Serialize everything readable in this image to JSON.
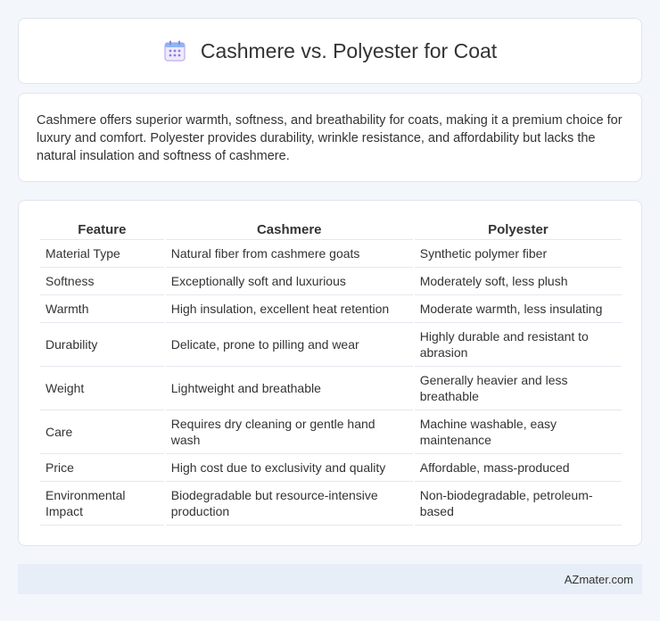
{
  "header": {
    "title": "Cashmere vs. Polyester for Coat",
    "icon": "calendar-grid-icon",
    "icon_color": "#8f7be0"
  },
  "intro": {
    "text": "Cashmere offers superior warmth, softness, and breathability for coats, making it a premium choice for luxury and comfort. Polyester provides durability, wrinkle resistance, and affordability but lacks the natural insulation and softness of cashmere."
  },
  "table": {
    "headers": [
      "Feature",
      "Cashmere",
      "Polyester"
    ],
    "rows": [
      {
        "feature": "Material Type",
        "cashmere": "Natural fiber from cashmere goats",
        "polyester": "Synthetic polymer fiber"
      },
      {
        "feature": "Softness",
        "cashmere": "Exceptionally soft and luxurious",
        "polyester": "Moderately soft, less plush"
      },
      {
        "feature": "Warmth",
        "cashmere": "High insulation, excellent heat retention",
        "polyester": "Moderate warmth, less insulating"
      },
      {
        "feature": "Durability",
        "cashmere": "Delicate, prone to pilling and wear",
        "polyester": "Highly durable and resistant to abrasion"
      },
      {
        "feature": "Weight",
        "cashmere": "Lightweight and breathable",
        "polyester": "Generally heavier and less breathable"
      },
      {
        "feature": "Care",
        "cashmere": "Requires dry cleaning or gentle hand wash",
        "polyester": "Machine washable, easy maintenance"
      },
      {
        "feature": "Price",
        "cashmere": "High cost due to exclusivity and quality",
        "polyester": "Affordable, mass-produced"
      },
      {
        "feature": "Environmental Impact",
        "cashmere": "Biodegradable but resource-intensive production",
        "polyester": "Non-biodegradable, petroleum-based"
      }
    ]
  },
  "footer": {
    "brand": "AZmater.com"
  }
}
